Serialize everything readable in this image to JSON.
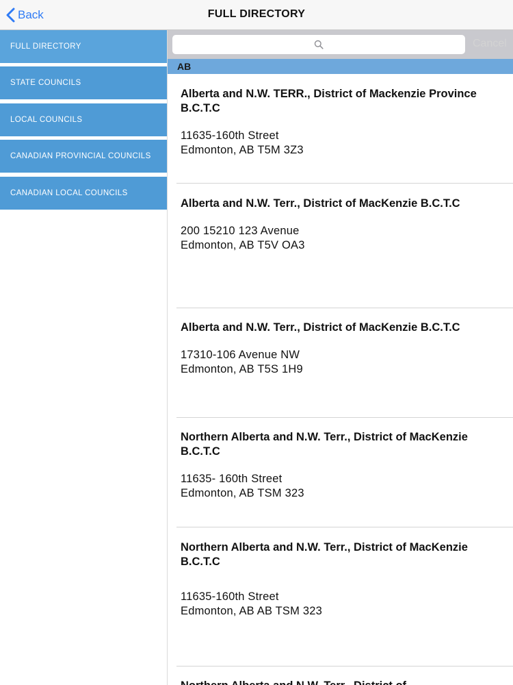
{
  "nav": {
    "back_label": "Back",
    "title": "FULL DIRECTORY"
  },
  "sidebar": {
    "items": [
      {
        "label": "FULL DIRECTORY"
      },
      {
        "label": "STATE COUNCILS"
      },
      {
        "label": "LOCAL COUNCILS"
      },
      {
        "label": "CANADIAN PROVINCIAL COUNCILS"
      },
      {
        "label": "CANADIAN LOCAL COUNCILS"
      }
    ]
  },
  "search": {
    "placeholder": "",
    "cancel_label": "Cancel"
  },
  "section": {
    "header": "AB"
  },
  "list": {
    "items": [
      {
        "name": "Alberta and N.W. TERR., District of Mackenzie Province B.C.T.C",
        "address_line1": "11635-160th Street",
        "address_line2": "Edmonton, AB T5M 3Z3"
      },
      {
        "name": "Alberta and N.W. Terr., District of MacKenzie B.C.T.C",
        "address_line1": "200 15210 123 Avenue",
        "address_line2": "Edmonton, AB T5V OA3"
      },
      {
        "name": "Alberta and N.W. Terr., District of MacKenzie B.C.T.C",
        "address_line1": "17310-106 Avenue NW",
        "address_line2": "Edmonton, AB T5S 1H9"
      },
      {
        "name": "Northern Alberta and N.W. Terr., District of MacKenzie B.C.T.C",
        "address_line1": "11635- 160th Street",
        "address_line2": "Edmonton, AB TSM 323"
      },
      {
        "name": "Northern Alberta and N.W. Terr., District of MacKenzie B.C.T.C",
        "address_line1": "11635-160th Street",
        "address_line2": "Edmonton, AB AB TSM 323"
      },
      {
        "name": "Northern Alberta and N.W. Terr., District of",
        "address_line1": "",
        "address_line2": ""
      }
    ]
  },
  "colors": {
    "accent_blue": "#2f7bf5",
    "sidebar_blue": "#4f9bd6",
    "section_header_blue": "#6ea8dc"
  }
}
